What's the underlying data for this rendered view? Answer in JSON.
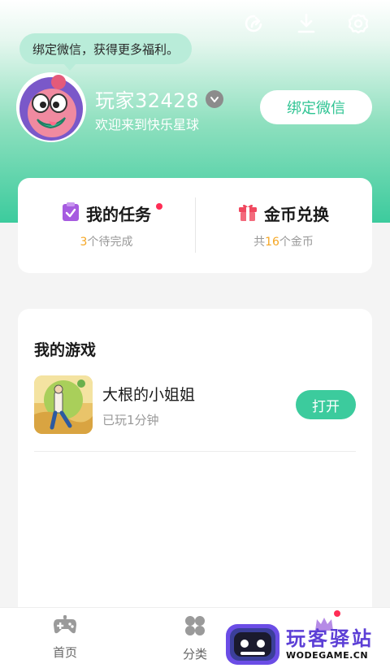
{
  "header": {
    "bind_tip": "绑定微信，获得更多福利。",
    "username": "玩家32428",
    "welcome": "欢迎来到快乐星球",
    "bind_button": "绑定微信",
    "icons": [
      "share-icon",
      "download-icon",
      "settings-gear-icon"
    ]
  },
  "stats": {
    "tasks": {
      "title": "我的任务",
      "count": "3",
      "suffix": "个待完成",
      "has_badge": true
    },
    "coins": {
      "title": "金币兑换",
      "prefix": "共",
      "count": "16",
      "suffix": "个金币"
    }
  },
  "games": {
    "title": "我的游戏",
    "items": [
      {
        "name": "大根的小姐姐",
        "played": "已玩1分钟",
        "action": "打开"
      }
    ]
  },
  "nav": {
    "items": [
      {
        "label": "首页",
        "icon": "gamepad-icon"
      },
      {
        "label": "分类",
        "icon": "category-grid-icon"
      }
    ]
  },
  "watermark": {
    "title": "玩客驿站",
    "subtitle": "WODEGAME.CN"
  },
  "colors": {
    "accent": "#3ccb9d",
    "badge": "#ff2d55",
    "highlight_number": "#f5a623"
  }
}
